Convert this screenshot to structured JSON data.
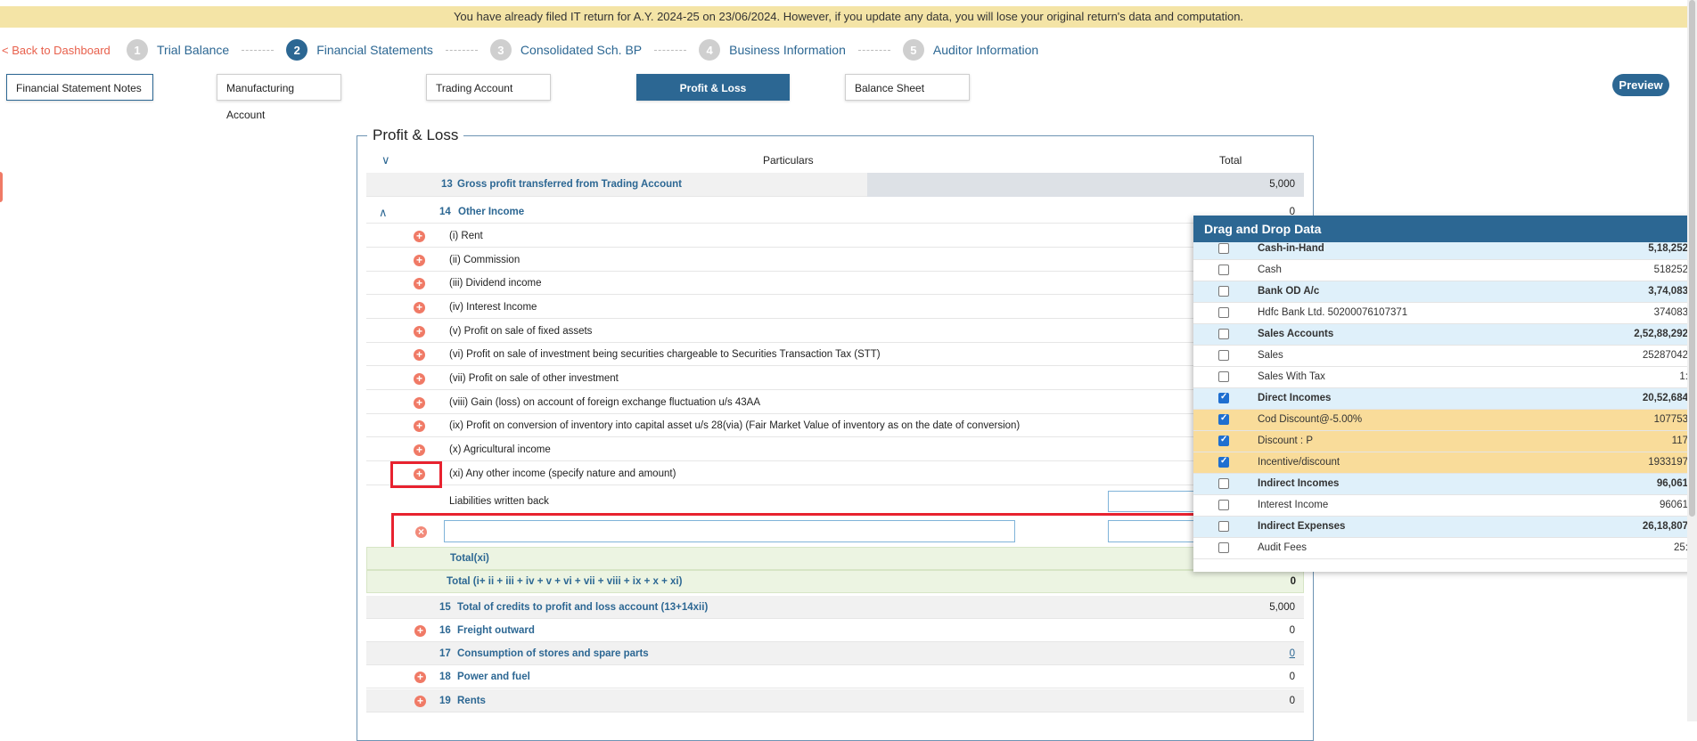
{
  "banner": "You have already filed IT return for A.Y. 2024-25 on 23/06/2024. However, if you update any data, you will lose your original return's data and computation.",
  "nav": {
    "back": "< Back to Dashboard",
    "steps": [
      {
        "num": "1",
        "label": "Trial Balance"
      },
      {
        "num": "2",
        "label": "Financial Statements"
      },
      {
        "num": "3",
        "label": "Consolidated Sch. BP"
      },
      {
        "num": "4",
        "label": "Business Information"
      },
      {
        "num": "5",
        "label": "Auditor Information"
      }
    ]
  },
  "tabs": [
    "Financial Statement Notes",
    "Manufacturing Account",
    "Trading Account",
    "Profit & Loss",
    "Balance Sheet"
  ],
  "preview": "Preview",
  "section": {
    "legend": "Profit & Loss",
    "col_particulars": "Particulars",
    "col_total": "Total",
    "row13": {
      "num": "13",
      "label": "Gross profit transferred from Trading Account",
      "value": "5,000"
    },
    "row14": {
      "num": "14",
      "label": "Other Income",
      "value": "0"
    },
    "items": [
      "(i) Rent",
      "(ii) Commission",
      "(iii) Dividend income",
      "(iv) Interest Income",
      "(v) Profit on sale of fixed assets",
      "(vi) Profit on sale of investment being securities chargeable to Securities Transaction Tax (STT)",
      "(vii) Profit on sale of other investment",
      "(viii) Gain (loss) on account of foreign exchange fluctuation u/s 43AA",
      "(ix) Profit on conversion of inventory into capital asset u/s 28(via) (Fair Market Value of inventory as on the date of conversion)",
      "(x) Agricultural income",
      "(xi) Any other income (specify nature and amount)"
    ],
    "liabilities": "Liabilities written back",
    "total_xi": "Total(xi)",
    "total_all": "Total (i+ ii + iii + iv + v + vi + vii + viii + ix + x + xi)",
    "total_all_value": "0",
    "row15": {
      "num": "15",
      "label": "Total of credits to profit and loss account (13+14xii)",
      "value": "5,000"
    },
    "row16": {
      "num": "16",
      "label": "Freight outward",
      "value": "0"
    },
    "row17": {
      "num": "17",
      "label": "Consumption of stores and spare parts",
      "value": "0"
    },
    "row18": {
      "num": "18",
      "label": "Power and fuel",
      "value": "0"
    },
    "row19": {
      "num": "19",
      "label": "Rents",
      "value": "0"
    }
  },
  "panel": {
    "title": "Drag and Drop Data",
    "rows": [
      {
        "label": "Cash-in-Hand",
        "value": "5,18,252",
        "kind": "group",
        "checked": false
      },
      {
        "label": "Cash",
        "value": "518252",
        "kind": "item",
        "checked": false
      },
      {
        "label": "Bank OD A/c",
        "value": "3,74,083",
        "kind": "group",
        "checked": false
      },
      {
        "label": "Hdfc Bank Ltd. 50200076107371",
        "value": "374083",
        "kind": "item",
        "checked": false
      },
      {
        "label": "Sales Accounts",
        "value": "2,52,88,292",
        "kind": "group",
        "checked": false
      },
      {
        "label": "Sales",
        "value": "25287042",
        "kind": "item",
        "checked": false
      },
      {
        "label": "Sales With Tax",
        "value": "1:",
        "kind": "item",
        "checked": false
      },
      {
        "label": "Direct Incomes",
        "value": "20,52,684",
        "kind": "group",
        "checked": true
      },
      {
        "label": "Cod Discount@-5.00%",
        "value": "107753",
        "kind": "checked",
        "checked": true
      },
      {
        "label": "Discount : P",
        "value": "117",
        "kind": "checked",
        "checked": true
      },
      {
        "label": "Incentive/discount",
        "value": "1933197",
        "kind": "checked",
        "checked": true
      },
      {
        "label": "Indirect Incomes",
        "value": "96,061",
        "kind": "group",
        "checked": false
      },
      {
        "label": "Interest Income",
        "value": "96061",
        "kind": "item",
        "checked": false
      },
      {
        "label": "Indirect Expenses",
        "value": "26,18,807",
        "kind": "group",
        "checked": false
      },
      {
        "label": "Audit Fees",
        "value": "25:",
        "kind": "item",
        "checked": false
      }
    ]
  }
}
